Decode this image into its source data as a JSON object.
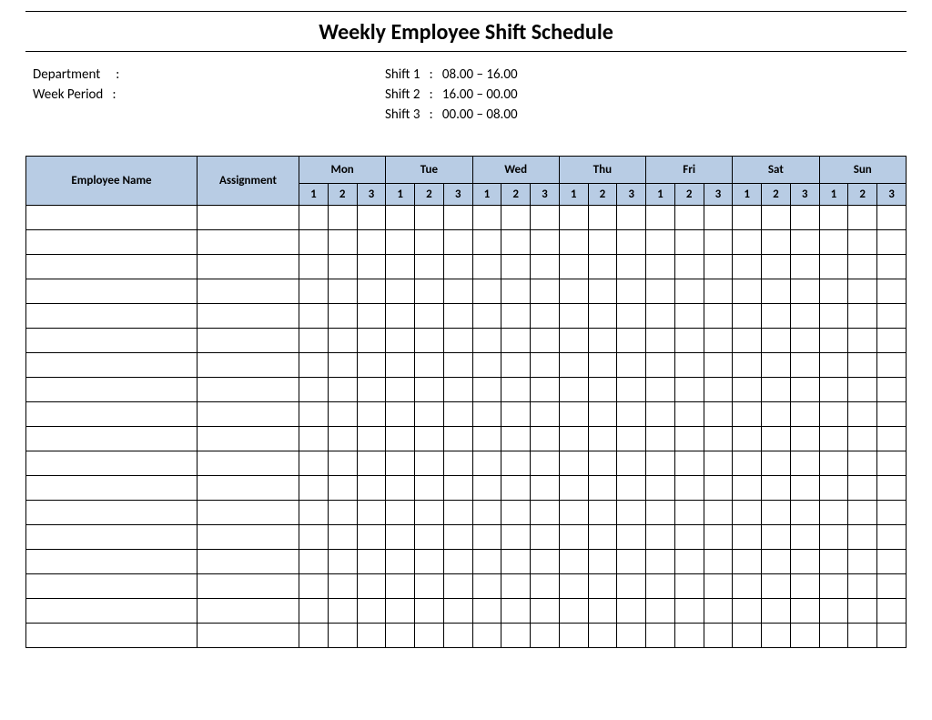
{
  "title": "Weekly Employee Shift Schedule",
  "meta": {
    "department_label": "Department",
    "department_sep": ":",
    "week_period_label": "Week  Period",
    "week_period_sep": ":",
    "shifts": [
      {
        "label": "Shift 1",
        "sep": ":",
        "range": "08.00  – 16.00"
      },
      {
        "label": "Shift 2",
        "sep": ":",
        "range": "16.00  – 00.00"
      },
      {
        "label": "Shift 3",
        "sep": ":",
        "range": "00.00  – 08.00"
      }
    ]
  },
  "headers": {
    "employee_name": "Employee Name",
    "assignment": "Assignment",
    "days": [
      "Mon",
      "Tue",
      "Wed",
      "Thu",
      "Fri",
      "Sat",
      "Sun"
    ],
    "sub_shifts": [
      "1",
      "2",
      "3"
    ]
  },
  "rows": [
    {},
    {},
    {},
    {},
    {},
    {},
    {},
    {},
    {},
    {},
    {},
    {},
    {},
    {},
    {},
    {},
    {},
    {}
  ]
}
